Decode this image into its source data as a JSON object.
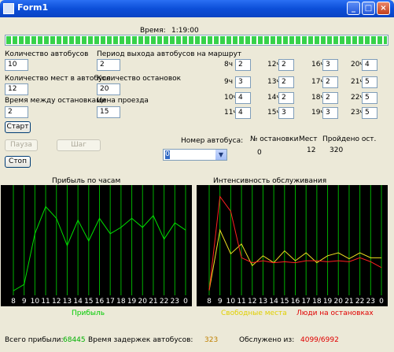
{
  "window": {
    "title": "Form1"
  },
  "clock": {
    "label": "Время:",
    "value": "1:19:00",
    "progress": 1.0
  },
  "fields": {
    "bus_count": {
      "label": "Количество автобусов",
      "value": "10"
    },
    "seats": {
      "label": "Количество мест в автобусе",
      "value": "12"
    },
    "time_between": {
      "label": "Время между остановками",
      "value": "2"
    },
    "period": {
      "label": "Период выхода автобусов на маршрут",
      "value": "2"
    },
    "stops": {
      "label": "Количество остановок",
      "value": "20"
    },
    "fare": {
      "label": "Цена проезда",
      "value": "15"
    }
  },
  "hours": [
    {
      "label": "8ч",
      "value": "2"
    },
    {
      "label": "12ч",
      "value": "2"
    },
    {
      "label": "16ч",
      "value": "3"
    },
    {
      "label": "20ч",
      "value": "4"
    },
    {
      "label": "9ч",
      "value": "3"
    },
    {
      "label": "13ч",
      "value": "2"
    },
    {
      "label": "17ч",
      "value": "2"
    },
    {
      "label": "21ч",
      "value": "5"
    },
    {
      "label": "10ч",
      "value": "4"
    },
    {
      "label": "14ч",
      "value": "2"
    },
    {
      "label": "18ч",
      "value": "2"
    },
    {
      "label": "22ч",
      "value": "5"
    },
    {
      "label": "11ч",
      "value": "4"
    },
    {
      "label": "15ч",
      "value": "3"
    },
    {
      "label": "19ч",
      "value": "3"
    },
    {
      "label": "23ч",
      "value": "5"
    }
  ],
  "buttons": {
    "start": "Старт",
    "pause": "Пауза",
    "step": "Шаг",
    "stop": "Стоп"
  },
  "bus": {
    "label": "Номер автобуса:",
    "selected": "0"
  },
  "info": {
    "stop_header": "№ остановки",
    "seats_header": "Мест",
    "passed_header": "Пройдено ост.",
    "stop_value": "0",
    "seats_value": "12",
    "passed_value": "320"
  },
  "chart_data": [
    {
      "type": "line",
      "title": "Прибыль по часам",
      "categories": [
        "8",
        "9",
        "10",
        "11",
        "12",
        "13",
        "14",
        "15",
        "16",
        "17",
        "18",
        "19",
        "20",
        "21",
        "22",
        "23",
        "0"
      ],
      "series": [
        {
          "name": "Прибыль",
          "color": "#00e000",
          "values": [
            5,
            12,
            68,
            98,
            85,
            55,
            83,
            60,
            85,
            68,
            75,
            85,
            75,
            88,
            62,
            80,
            72
          ]
        }
      ],
      "ylim": [
        0,
        120
      ],
      "grid": "vertical"
    },
    {
      "type": "line",
      "title": "Интенсивность обслуживания",
      "categories": [
        "8",
        "9",
        "10",
        "11",
        "12",
        "13",
        "14",
        "15",
        "16",
        "17",
        "18",
        "19",
        "20",
        "21",
        "22",
        "23",
        "0"
      ],
      "series": [
        {
          "name": "Свободные места",
          "color": "#f0e020",
          "values": [
            5,
            66,
            42,
            52,
            30,
            40,
            33,
            45,
            35,
            43,
            33,
            40,
            43,
            37,
            43,
            38,
            38
          ]
        },
        {
          "name": "Люди на остановках",
          "color": "#ff2020",
          "values": [
            5,
            100,
            85,
            38,
            33,
            35,
            33,
            34,
            33,
            35,
            35,
            34,
            35,
            34,
            38,
            34,
            28
          ]
        }
      ],
      "ylim": [
        0,
        110
      ],
      "grid": "vertical"
    }
  ],
  "summary": {
    "profit_label": "Всего прибыли:",
    "profit_value": "68445",
    "delay_label": "Время задержек автобусов:",
    "delay_value": "323",
    "served_label": "Обслужено из:",
    "served_value": "4099/6992"
  },
  "colors": {
    "profit": "#00cc00",
    "free": "#e0d000",
    "people": "#e00000",
    "summary_value": "#c08000"
  }
}
